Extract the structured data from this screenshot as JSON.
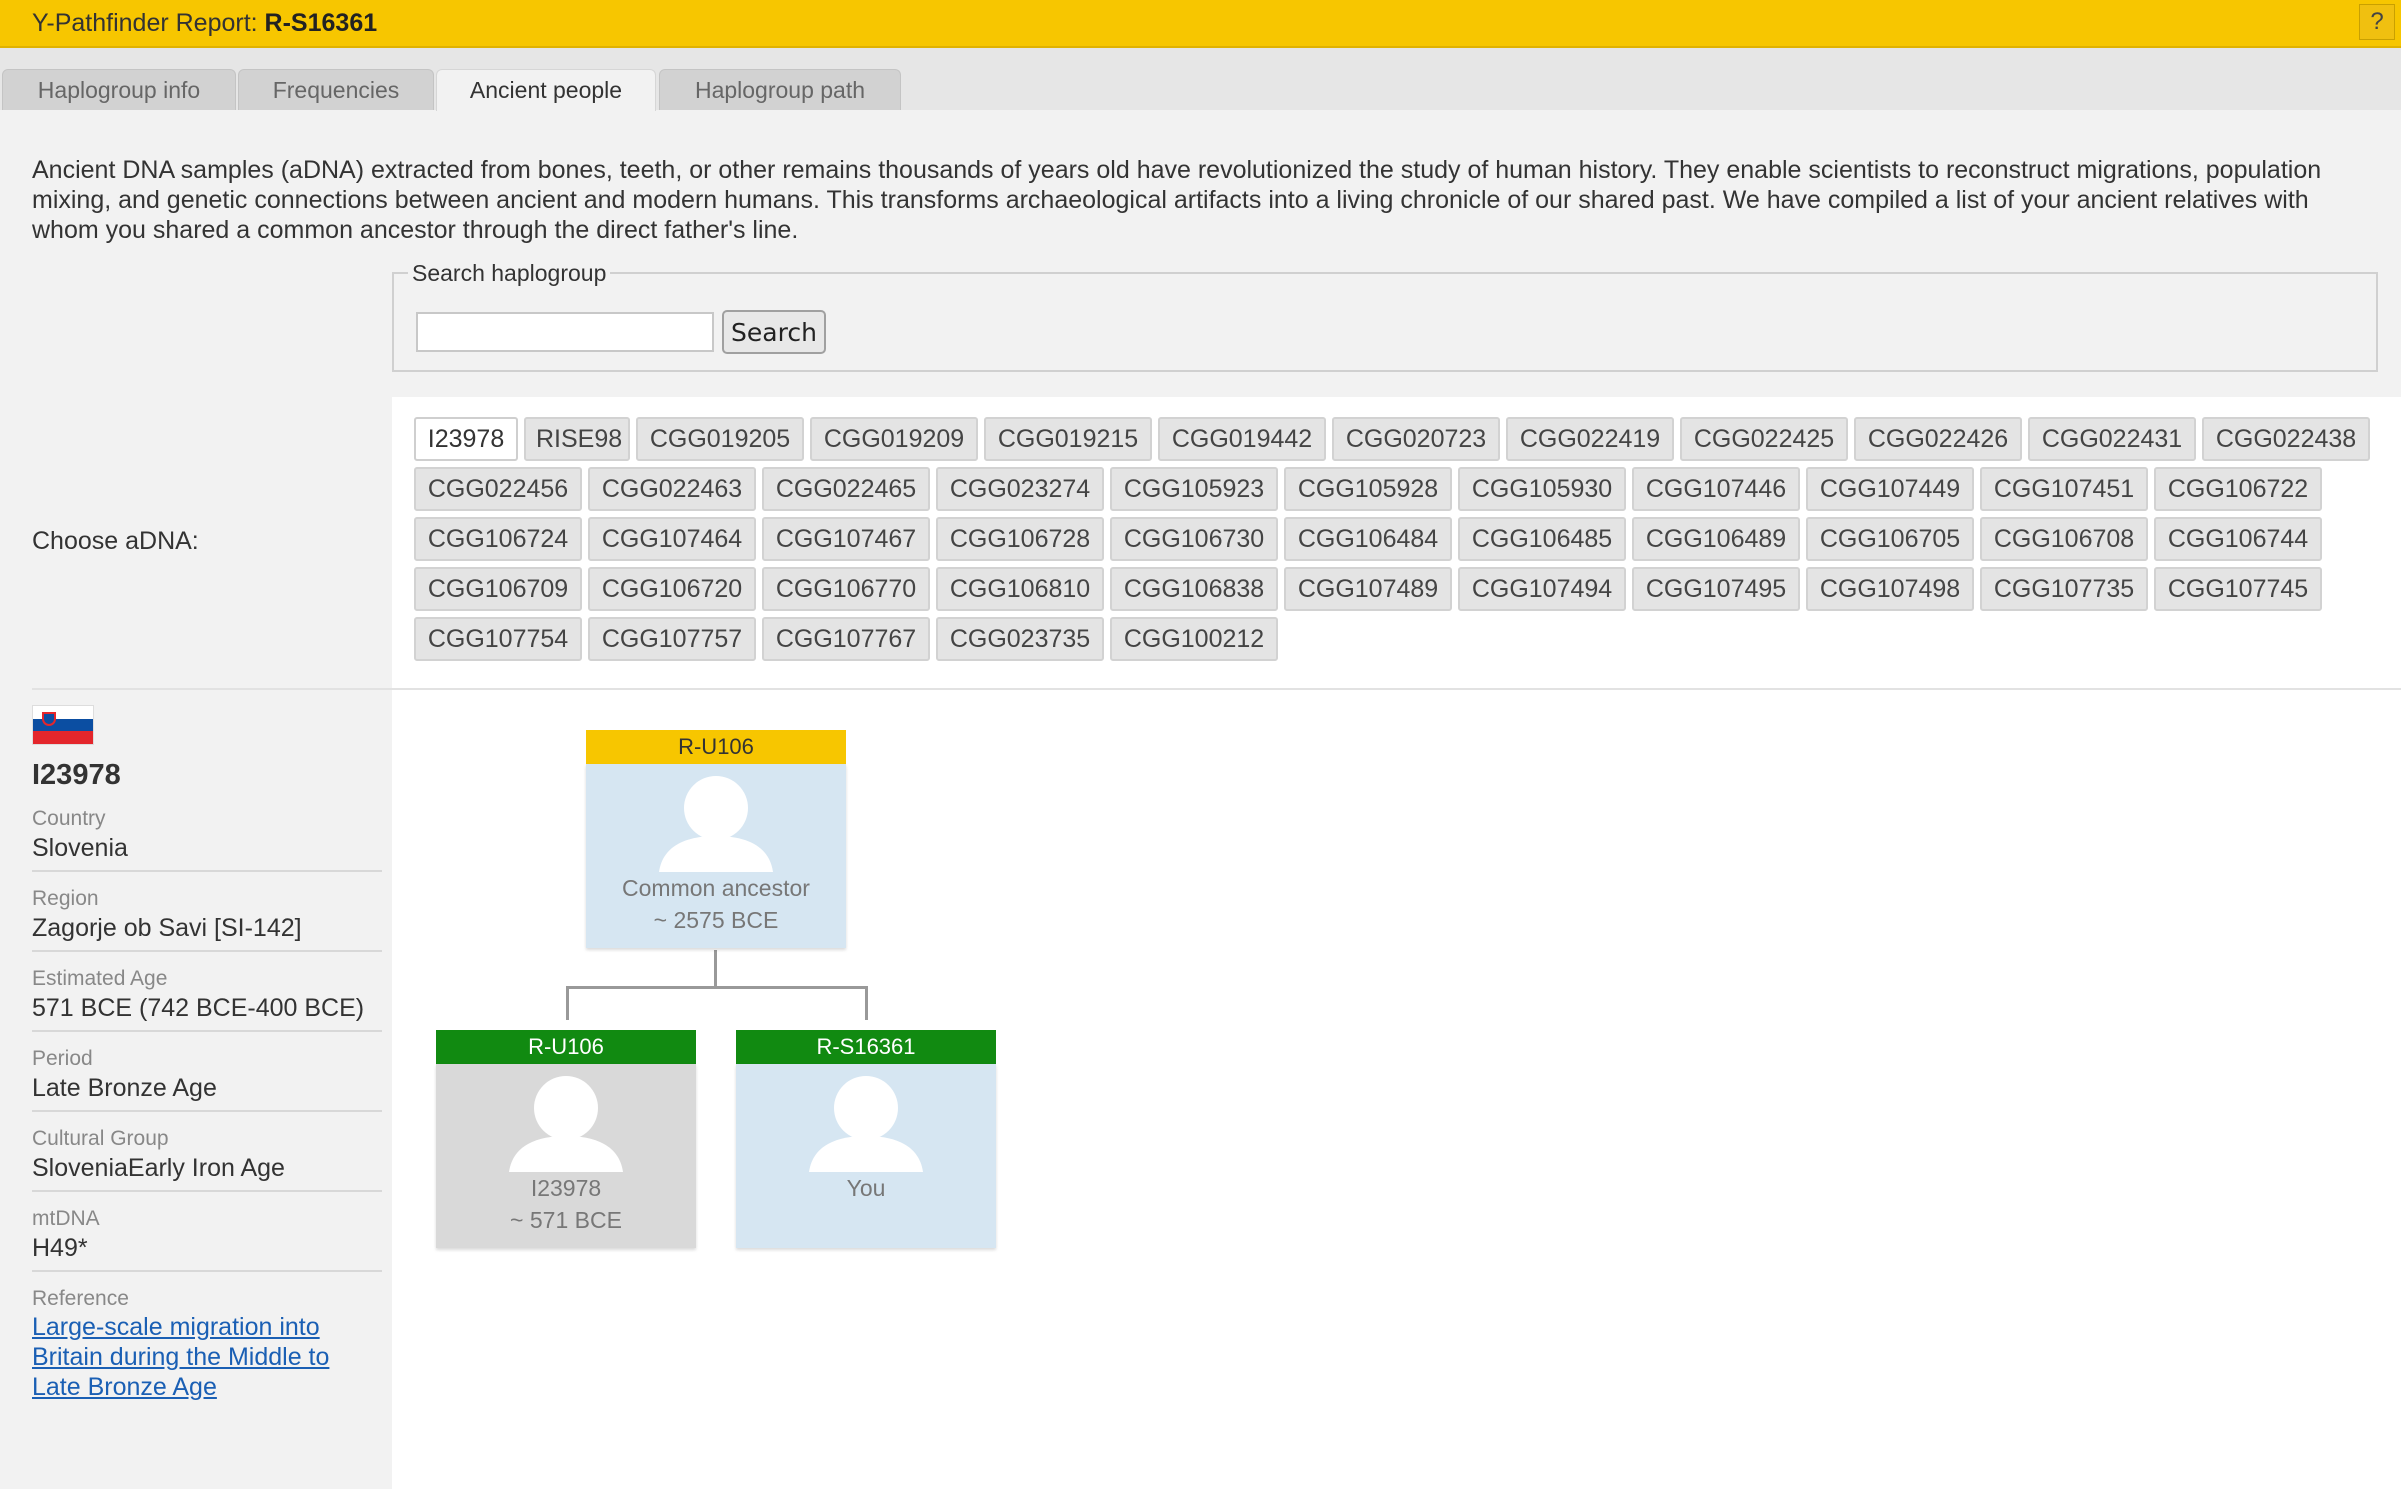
{
  "header": {
    "title_prefix": "Y-Pathfinder Report: ",
    "title_haplogroup": "R-S16361",
    "help_label": "?"
  },
  "tabs": [
    {
      "label": "Haplogroup info",
      "active": false
    },
    {
      "label": "Frequencies",
      "active": false
    },
    {
      "label": "Ancient people",
      "active": true
    },
    {
      "label": "Haplogroup path",
      "active": false
    }
  ],
  "intro": "Ancient DNA samples (aDNA) extracted from bones, teeth, or other remains thousands of years old have revolutionized the study of human history. They enable scientists to reconstruct migrations, population mixing, and genetic connections between ancient and modern humans. This transforms archaeological artifacts into a living chronicle of our shared past. We have compiled a list of your ancient relatives with whom you shared a common ancestor through the direct father's line.",
  "search": {
    "legend": "Search haplogroup",
    "value": "",
    "placeholder": "",
    "button_label": "Search"
  },
  "choose_label": "Choose aDNA:",
  "samples": [
    "I23978",
    "RISE98",
    "CGG019205",
    "CGG019209",
    "CGG019215",
    "CGG019442",
    "CGG020723",
    "CGG022419",
    "CGG022425",
    "CGG022426",
    "CGG022431",
    "CGG022438",
    "CGG022456",
    "CGG022463",
    "CGG022465",
    "CGG023274",
    "CGG105923",
    "CGG105928",
    "CGG105930",
    "CGG107446",
    "CGG107449",
    "CGG107451",
    "CGG106722",
    "CGG106724",
    "CGG107464",
    "CGG107467",
    "CGG106728",
    "CGG106730",
    "CGG106484",
    "CGG106485",
    "CGG106489",
    "CGG106705",
    "CGG106708",
    "CGG106744",
    "CGG106709",
    "CGG106720",
    "CGG106770",
    "CGG106810",
    "CGG106838",
    "CGG107489",
    "CGG107494",
    "CGG107495",
    "CGG107498",
    "CGG107735",
    "CGG107745",
    "CGG107754",
    "CGG107757",
    "CGG107767",
    "CGG023735",
    "CGG100212"
  ],
  "selected_sample": "I23978",
  "info": {
    "flag": "slovenia-flag",
    "id": "I23978",
    "fields": [
      {
        "label": "Country",
        "value": "Slovenia"
      },
      {
        "label": "Region",
        "value": "Zagorje ob Savi [SI-142]"
      },
      {
        "label": "Estimated Age",
        "value": "571 BCE (742 BCE-400 BCE)"
      },
      {
        "label": "Period",
        "value": "Late Bronze Age"
      },
      {
        "label": "Cultural Group",
        "value": "SloveniaEarly Iron Age"
      },
      {
        "label": "mtDNA",
        "value": "H49*"
      }
    ],
    "reference_label": "Reference",
    "reference_link": "Large-scale migration into Britain during the Middle to Late Bronze Age"
  },
  "tree": {
    "ancestor": {
      "haplogroup": "R-U106",
      "line1": "Common ancestor",
      "line2": "~ 2575 BCE"
    },
    "sample": {
      "haplogroup": "R-U106",
      "line1": "I23978",
      "line2": "~ 571 BCE"
    },
    "you": {
      "haplogroup": "R-S16361",
      "line1": "You"
    }
  },
  "colors": {
    "header": "#f7c600",
    "tree_green": "#118a11",
    "node_blue": "#d6e6f2",
    "node_gray": "#d9d9d9",
    "link": "#1a5fb4"
  }
}
